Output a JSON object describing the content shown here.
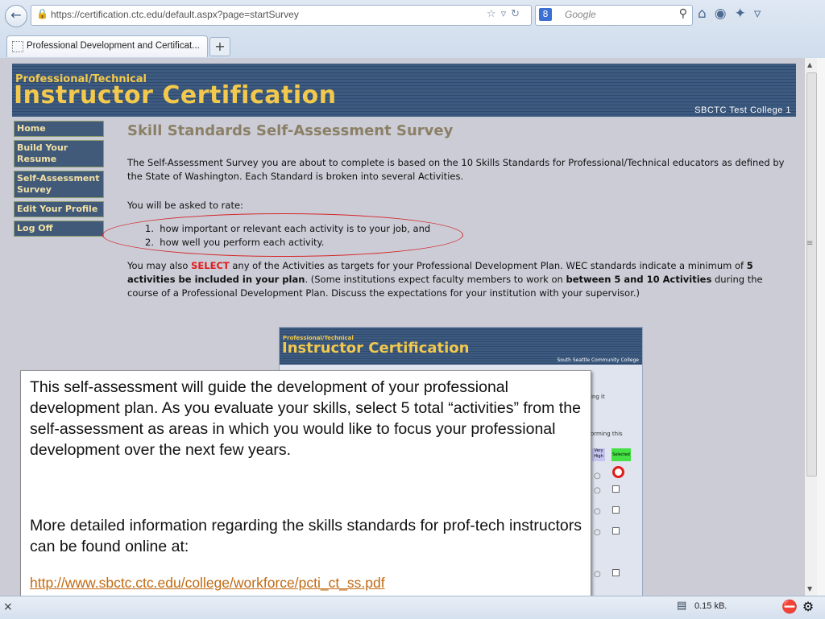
{
  "browser": {
    "url": "https://certification.ctc.edu/default.aspx?page=startSurvey",
    "search_placeholder": "Google",
    "tab_title": "Professional Development and Certificat...",
    "new_tab": "+",
    "status_size": "0.15 kB."
  },
  "site": {
    "header_subtitle": "Professional/Technical",
    "header_title": "Instructor Certification",
    "college": "SBCTC Test College 1"
  },
  "nav": {
    "items": [
      {
        "label": "Home"
      },
      {
        "label": "Build Your Resume"
      },
      {
        "label": "Self-Assessment Survey"
      },
      {
        "label": "Edit Your Profile"
      },
      {
        "label": "Log Off"
      }
    ]
  },
  "survey": {
    "title": "Skill Standards Self-Assessment Survey",
    "intro": "The Self-Assessment Survey you are about to complete is based on the 10 Skills Standards for Professional/Technical educators as defined by the State of Washington. Each Standard is broken into several Activities.",
    "rate_intro": "You will be asked to rate:",
    "rate_items": [
      "how important or relevant each activity is to your job, and",
      "how well you perform each activity."
    ],
    "select_p_a": "You may also ",
    "select_word": "SELECT",
    "select_p_b": " any of the Activities as targets for your Professional Development Plan. WEC standards indicate a minimum of ",
    "select_bold1": "5 activities be included in your plan",
    "select_p_c": ". (Some institutions expect faculty members to work on ",
    "select_bold2": "between 5 and 10 Activities",
    "select_p_d": " during the course of a Professional Development Plan. Discuss the expectations for your institution with your supervisor.)"
  },
  "inset": {
    "subtitle": "Professional/Technical",
    "title": "Instructor Certification",
    "college": "South Seattle Community College",
    "frag1": "ing it",
    "frag2": "orming this",
    "col_very": "Very High",
    "col_selected": "Selected"
  },
  "callout": {
    "p1": "This self-assessment will guide the development of your professional development plan.  As you evaluate your skills, select 5 total “activities” from the self-assessment as areas in which you would like to focus your professional development over the next few years.",
    "p2": "More detailed information regarding the skills standards for prof-tech instructors can be found online at:",
    "link": "http://www.sbctc.ctc.edu/college/workforce/pcti_ct_ss.pdf"
  },
  "icons": [
    "back-icon",
    "lock-icon",
    "star-icon",
    "reload-icon",
    "search-icon",
    "home-icon",
    "addon-icon",
    "close-icon"
  ],
  "colors": {
    "header_band": "#3d5a80",
    "header_text": "#f2c94c",
    "page_bg": "#ccccd7",
    "nav_bg": "#415a7a",
    "highlight_red": "#e01b1b",
    "selected_green": "#44e044"
  }
}
